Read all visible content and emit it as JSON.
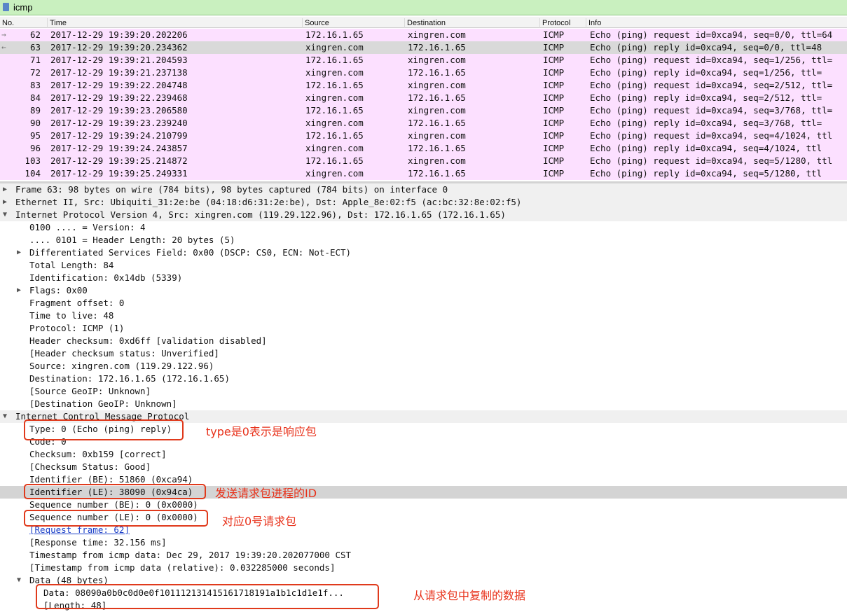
{
  "filter": {
    "value": "icmp"
  },
  "columns": [
    "No.",
    "Time",
    "Source",
    "Destination",
    "Protocol",
    "Info"
  ],
  "packets": [
    {
      "no": "62",
      "time": "2017-12-29 19:39:20.202206",
      "src": "172.16.1.65",
      "dst": "xingren.com",
      "proto": "ICMP",
      "info": "Echo (ping) request  id=0xca94, seq=0/0, ttl=64",
      "arrow": "→",
      "selected": false
    },
    {
      "no": "63",
      "time": "2017-12-29 19:39:20.234362",
      "src": "xingren.com",
      "dst": "172.16.1.65",
      "proto": "ICMP",
      "info": "Echo (ping) reply    id=0xca94, seq=0/0, ttl=48",
      "arrow": "←",
      "selected": true
    },
    {
      "no": "71",
      "time": "2017-12-29 19:39:21.204593",
      "src": "172.16.1.65",
      "dst": "xingren.com",
      "proto": "ICMP",
      "info": "Echo (ping) request  id=0xca94, seq=1/256, ttl=",
      "arrow": "",
      "selected": false
    },
    {
      "no": "72",
      "time": "2017-12-29 19:39:21.237138",
      "src": "xingren.com",
      "dst": "172.16.1.65",
      "proto": "ICMP",
      "info": "Echo (ping) reply    id=0xca94, seq=1/256, ttl=",
      "arrow": "",
      "selected": false
    },
    {
      "no": "83",
      "time": "2017-12-29 19:39:22.204748",
      "src": "172.16.1.65",
      "dst": "xingren.com",
      "proto": "ICMP",
      "info": "Echo (ping) request  id=0xca94, seq=2/512, ttl=",
      "arrow": "",
      "selected": false
    },
    {
      "no": "84",
      "time": "2017-12-29 19:39:22.239468",
      "src": "xingren.com",
      "dst": "172.16.1.65",
      "proto": "ICMP",
      "info": "Echo (ping) reply    id=0xca94, seq=2/512, ttl=",
      "arrow": "",
      "selected": false
    },
    {
      "no": "89",
      "time": "2017-12-29 19:39:23.206580",
      "src": "172.16.1.65",
      "dst": "xingren.com",
      "proto": "ICMP",
      "info": "Echo (ping) request  id=0xca94, seq=3/768, ttl=",
      "arrow": "",
      "selected": false
    },
    {
      "no": "90",
      "time": "2017-12-29 19:39:23.239240",
      "src": "xingren.com",
      "dst": "172.16.1.65",
      "proto": "ICMP",
      "info": "Echo (ping) reply    id=0xca94, seq=3/768, ttl=",
      "arrow": "",
      "selected": false
    },
    {
      "no": "95",
      "time": "2017-12-29 19:39:24.210799",
      "src": "172.16.1.65",
      "dst": "xingren.com",
      "proto": "ICMP",
      "info": "Echo (ping) request  id=0xca94, seq=4/1024, ttl",
      "arrow": "",
      "selected": false
    },
    {
      "no": "96",
      "time": "2017-12-29 19:39:24.243857",
      "src": "xingren.com",
      "dst": "172.16.1.65",
      "proto": "ICMP",
      "info": "Echo (ping) reply    id=0xca94, seq=4/1024, ttl",
      "arrow": "",
      "selected": false
    },
    {
      "no": "103",
      "time": "2017-12-29 19:39:25.214872",
      "src": "172.16.1.65",
      "dst": "xingren.com",
      "proto": "ICMP",
      "info": "Echo (ping) request  id=0xca94, seq=5/1280, ttl",
      "arrow": "",
      "selected": false
    },
    {
      "no": "104",
      "time": "2017-12-29 19:39:25.249331",
      "src": "xingren.com",
      "dst": "172.16.1.65",
      "proto": "ICMP",
      "info": "Echo (ping) reply    id=0xca94, seq=5/1280, ttl",
      "arrow": "",
      "selected": false
    }
  ],
  "details": [
    {
      "text": "Frame 63: 98 bytes on wire (784 bits), 98 bytes captured (784 bits) on interface 0",
      "level": 0,
      "toggle": "collapsed",
      "section": true
    },
    {
      "text": "Ethernet II, Src: Ubiquiti_31:2e:be (04:18:d6:31:2e:be), Dst: Apple_8e:02:f5 (ac:bc:32:8e:02:f5)",
      "level": 0,
      "toggle": "collapsed",
      "section": true
    },
    {
      "text": "Internet Protocol Version 4, Src: xingren.com (119.29.122.96), Dst: 172.16.1.65 (172.16.1.65)",
      "level": 0,
      "toggle": "expanded",
      "section": true
    },
    {
      "text": "0100 .... = Version: 4",
      "level": 1
    },
    {
      "text": ".... 0101 = Header Length: 20 bytes (5)",
      "level": 1
    },
    {
      "text": "Differentiated Services Field: 0x00 (DSCP: CS0, ECN: Not-ECT)",
      "level": 1,
      "toggle": "collapsed"
    },
    {
      "text": "Total Length: 84",
      "level": 1
    },
    {
      "text": "Identification: 0x14db (5339)",
      "level": 1
    },
    {
      "text": "Flags: 0x00",
      "level": 1,
      "toggle": "collapsed"
    },
    {
      "text": "Fragment offset: 0",
      "level": 1
    },
    {
      "text": "Time to live: 48",
      "level": 1
    },
    {
      "text": "Protocol: ICMP (1)",
      "level": 1
    },
    {
      "text": "Header checksum: 0xd6ff [validation disabled]",
      "level": 1
    },
    {
      "text": "[Header checksum status: Unverified]",
      "level": 1
    },
    {
      "text": "Source: xingren.com (119.29.122.96)",
      "level": 1
    },
    {
      "text": "Destination: 172.16.1.65 (172.16.1.65)",
      "level": 1
    },
    {
      "text": "[Source GeoIP: Unknown]",
      "level": 1
    },
    {
      "text": "[Destination GeoIP: Unknown]",
      "level": 1
    },
    {
      "text": "Internet Control Message Protocol",
      "level": 0,
      "toggle": "expanded",
      "section": true
    },
    {
      "text": "Type: 0 (Echo (ping) reply)",
      "level": 1
    },
    {
      "text": "Code: 0",
      "level": 1
    },
    {
      "text": "Checksum: 0xb159 [correct]",
      "level": 1
    },
    {
      "text": "[Checksum Status: Good]",
      "level": 1
    },
    {
      "text": "Identifier (BE): 51860 (0xca94)",
      "level": 1
    },
    {
      "text": "Identifier (LE): 38090 (0x94ca)",
      "level": 1,
      "highlight": true
    },
    {
      "text": "Sequence number (BE): 0 (0x0000)",
      "level": 1
    },
    {
      "text": "Sequence number (LE): 0 (0x0000)",
      "level": 1
    },
    {
      "text": "[Request frame: 62]",
      "level": 1,
      "link": true
    },
    {
      "text": "[Response time: 32.156 ms]",
      "level": 1
    },
    {
      "text": "Timestamp from icmp data: Dec 29, 2017 19:39:20.202077000 CST",
      "level": 1
    },
    {
      "text": "[Timestamp from icmp data (relative): 0.032285000 seconds]",
      "level": 1
    },
    {
      "text": "Data (48 bytes)",
      "level": 1,
      "toggle": "expanded",
      "section": true
    },
    {
      "text": "Data: 08090a0b0c0d0e0f101112131415161718191a1b1c1d1e1f...",
      "level": 2
    },
    {
      "text": "[Length: 48]",
      "level": 2
    }
  ],
  "annotations": {
    "type_note": "type是0表示是响应包",
    "identifier_note": "发送请求包进程的ID",
    "sequence_note": "对应0号请求包",
    "data_note": "从请求包中复制的数据"
  },
  "colors": {
    "row_bg": "#fce0ff",
    "selected_bg": "#d9d9d9",
    "annotation": "#e8321b",
    "filter_bg": "#c9f0bf"
  }
}
